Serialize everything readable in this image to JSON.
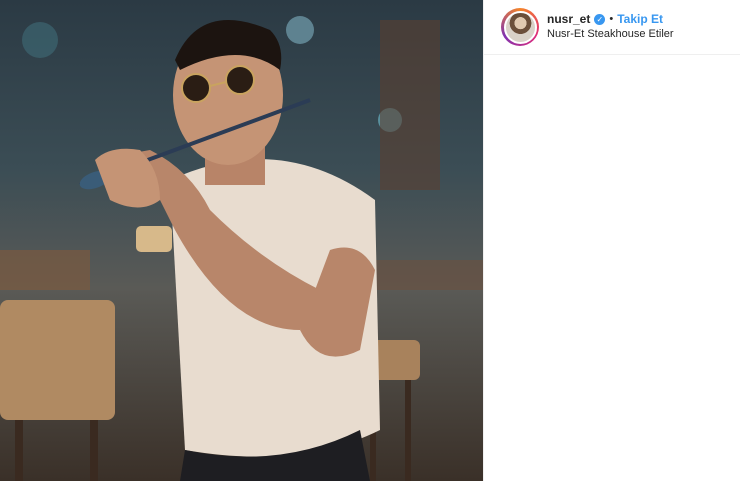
{
  "post": {
    "image_alt": "Man in sunglasses and white t-shirt holding glasses in mouth",
    "username": "nusr_et",
    "verified_icon": "verified-badge-icon",
    "separator": "•",
    "follow_label": "Takip Et",
    "location": "Nusr-Et Steakhouse Etiler"
  },
  "colors": {
    "accent": "#3897f0",
    "text": "#262626",
    "border": "#efefef"
  }
}
